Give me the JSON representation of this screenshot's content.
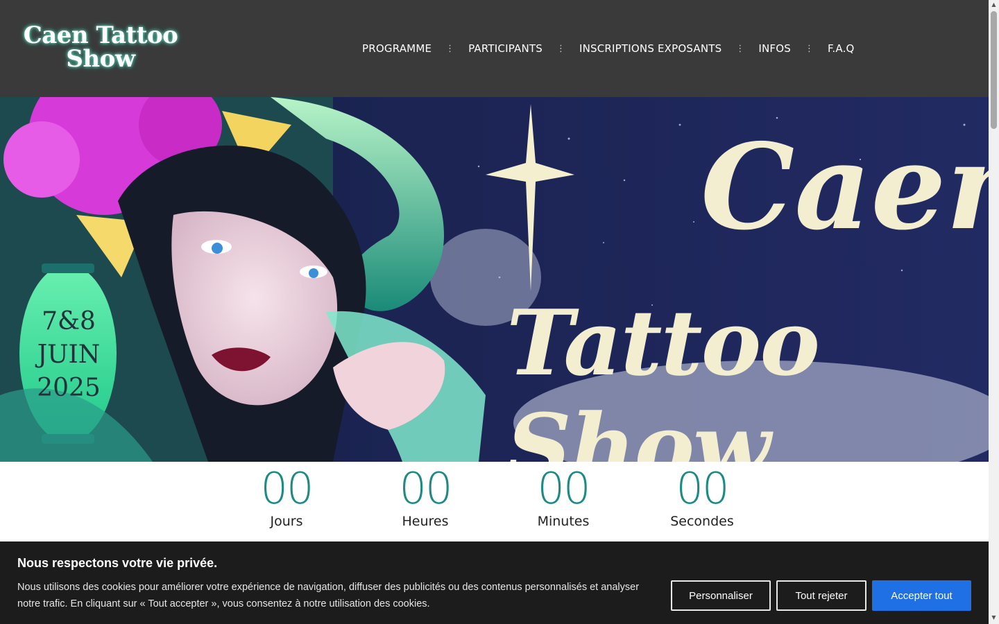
{
  "header": {
    "logo_line1": "Caen Tattoo",
    "logo_line2": "Show",
    "nav": [
      {
        "label": "PROGRAMME"
      },
      {
        "label": "PARTICIPANTS"
      },
      {
        "label": "INSCRIPTIONS EXPOSANTS"
      },
      {
        "label": "INFOS"
      },
      {
        "label": "F.A.Q"
      }
    ],
    "separator": "⋮"
  },
  "hero": {
    "date_line1": "7&8",
    "date_line2": "JUIN",
    "date_line3": "2025",
    "title_line1": "Caen",
    "title_line2": "Tattoo Show"
  },
  "countdown": {
    "days": {
      "value": "00",
      "label": "Jours"
    },
    "hours": {
      "value": "00",
      "label": "Heures"
    },
    "minutes": {
      "value": "00",
      "label": "Minutes"
    },
    "seconds": {
      "value": "00",
      "label": "Secondes"
    }
  },
  "cookie_banner": {
    "title": "Nous respectons votre vie privée.",
    "text": "Nous utilisons des cookies pour améliorer votre expérience de navigation, diffuser des publicités ou des contenus personnalisés et analyser notre trafic. En cliquant sur « Tout accepter », vous consentez à notre utilisation des cookies.",
    "customize_label": "Personnaliser",
    "reject_label": "Tout rejeter",
    "accept_label": "Accepter tout"
  },
  "colors": {
    "header_bg": "#3a3a3a",
    "countdown_accent": "#1e8a84",
    "accept_button": "#1f6fe5",
    "cookie_bg": "#1c1c1c"
  }
}
